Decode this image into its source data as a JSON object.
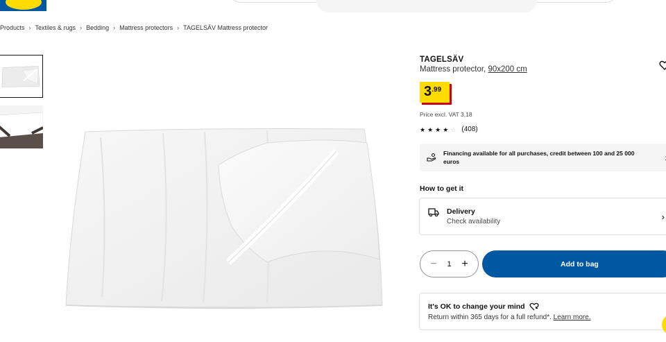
{
  "breadcrumb": {
    "items": [
      "Products",
      "Textiles & rugs",
      "Bedding",
      "Mattress protectors",
      "TAGELSÄV Mattress protector"
    ]
  },
  "product": {
    "name": "TAGELSÄV",
    "description": "Mattress protector, ",
    "size": "90x200 cm",
    "price_int": "3",
    "price_dec": ".99",
    "vat_text": "Price excl. VAT 3,18",
    "rating": 4,
    "rating_max": 5,
    "review_count": "(408)"
  },
  "financing": {
    "text": "Financing available for all purchases, credit between 100 and 25 000 euros"
  },
  "how_to_get": {
    "title": "How to get it",
    "delivery_title": "Delivery",
    "delivery_sub": "Check availability"
  },
  "purchase": {
    "quantity": "1",
    "add_to_bag": "Add to bag"
  },
  "change_mind": {
    "title": "It's OK to change your mind",
    "text": "Return within 365 days for a full refund*. ",
    "link": "Learn more."
  },
  "colors": {
    "brand_blue": "#0058a3",
    "brand_yellow": "#ffdb00",
    "price_shadow": "#cc0008"
  },
  "icons": [
    "heart-icon",
    "hand-coins-icon",
    "truck-icon",
    "chevron-right-icon",
    "minus-icon",
    "plus-icon",
    "heart-return-icon",
    "chat-icon"
  ]
}
